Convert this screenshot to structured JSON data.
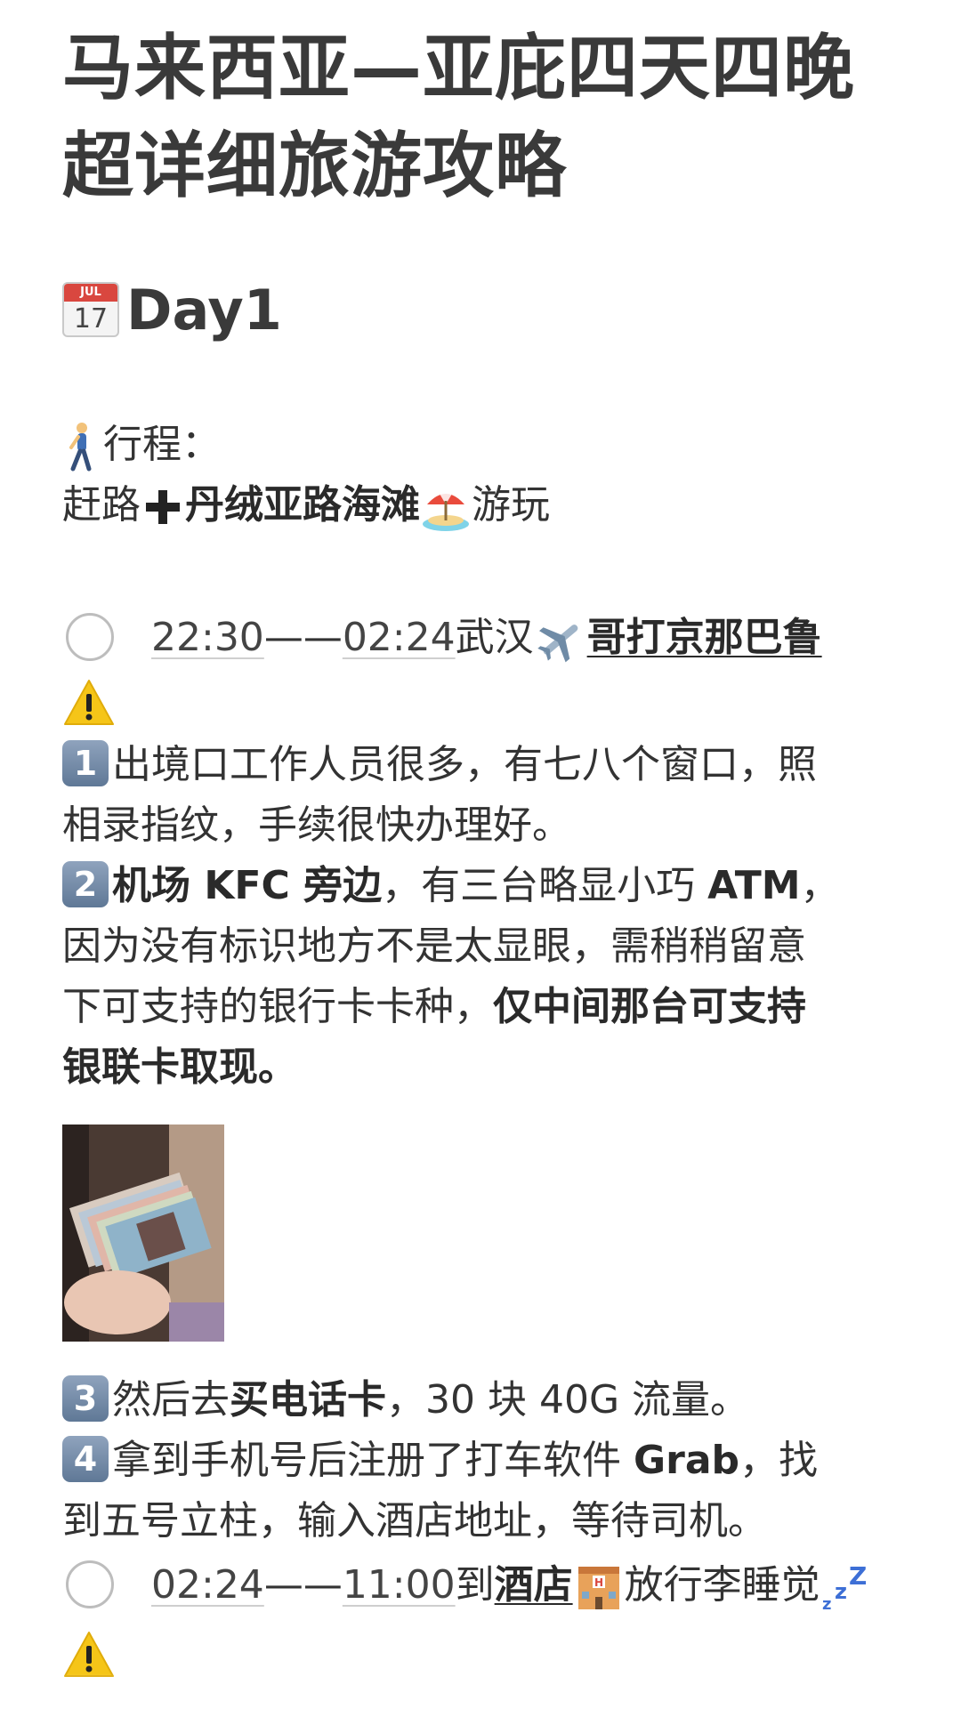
{
  "title": {
    "line1": "马来西亚—亚庇四天四晚",
    "line2": "超详细旅游攻略"
  },
  "day": {
    "calendar_month": "JUL",
    "calendar_day": "17",
    "label": "Day1"
  },
  "itinerary": {
    "label": "行程：",
    "route_part1": "赶路",
    "route_bold": "丹绒亚路海滩",
    "route_part2": "游玩"
  },
  "items": [
    {
      "time_start": "22:30",
      "dash": "——",
      "time_end": "02:24",
      "place": "武汉",
      "destination": "哥打京那巴鲁"
    },
    {
      "time_start": "02:24",
      "dash": "——",
      "time_end": "11:00",
      "prefix": "到",
      "destination": "酒店",
      "suffix": "放行李睡觉"
    }
  ],
  "notes": {
    "n1": {
      "badge": "1",
      "line1": "出境口工作人员很多，有七八个窗口，照",
      "line2": "相录指纹，手续很快办理好。"
    },
    "n2": {
      "badge": "2",
      "bold1": "机场 KFC 旁边",
      "text1": "，有三台略显小巧 ",
      "bold2": "ATM",
      "text1b": "，",
      "line2": "因为没有标识地方不是太显眼，需稍稍留意",
      "line3a": "下可支持的银行卡卡种，",
      "line3b": "仅中间那台可支持",
      "line4": "银联卡取现。"
    },
    "n3": {
      "badge": "3",
      "text1": "然后去",
      "bold": "买电话卡",
      "text2": "，30 块 40G 流量。"
    },
    "n4": {
      "badge": "4",
      "text1": "拿到手机号后注册了打车软件 ",
      "bold": "Grab",
      "text2": "，找",
      "line2": "到五号立柱，输入酒店地址，等待司机。"
    }
  },
  "icons": {
    "calendar": "calendar-icon",
    "walker": "person-walking-icon",
    "plus": "heavy-plus-icon",
    "beach": "beach-umbrella-icon",
    "plane": "airplane-icon",
    "warning": "warning-icon",
    "hotel": "hotel-icon",
    "sleep": "zzz-icon"
  },
  "colors": {
    "text": "#333333",
    "badge": "#6f86a3",
    "warning": "#f5c518"
  }
}
